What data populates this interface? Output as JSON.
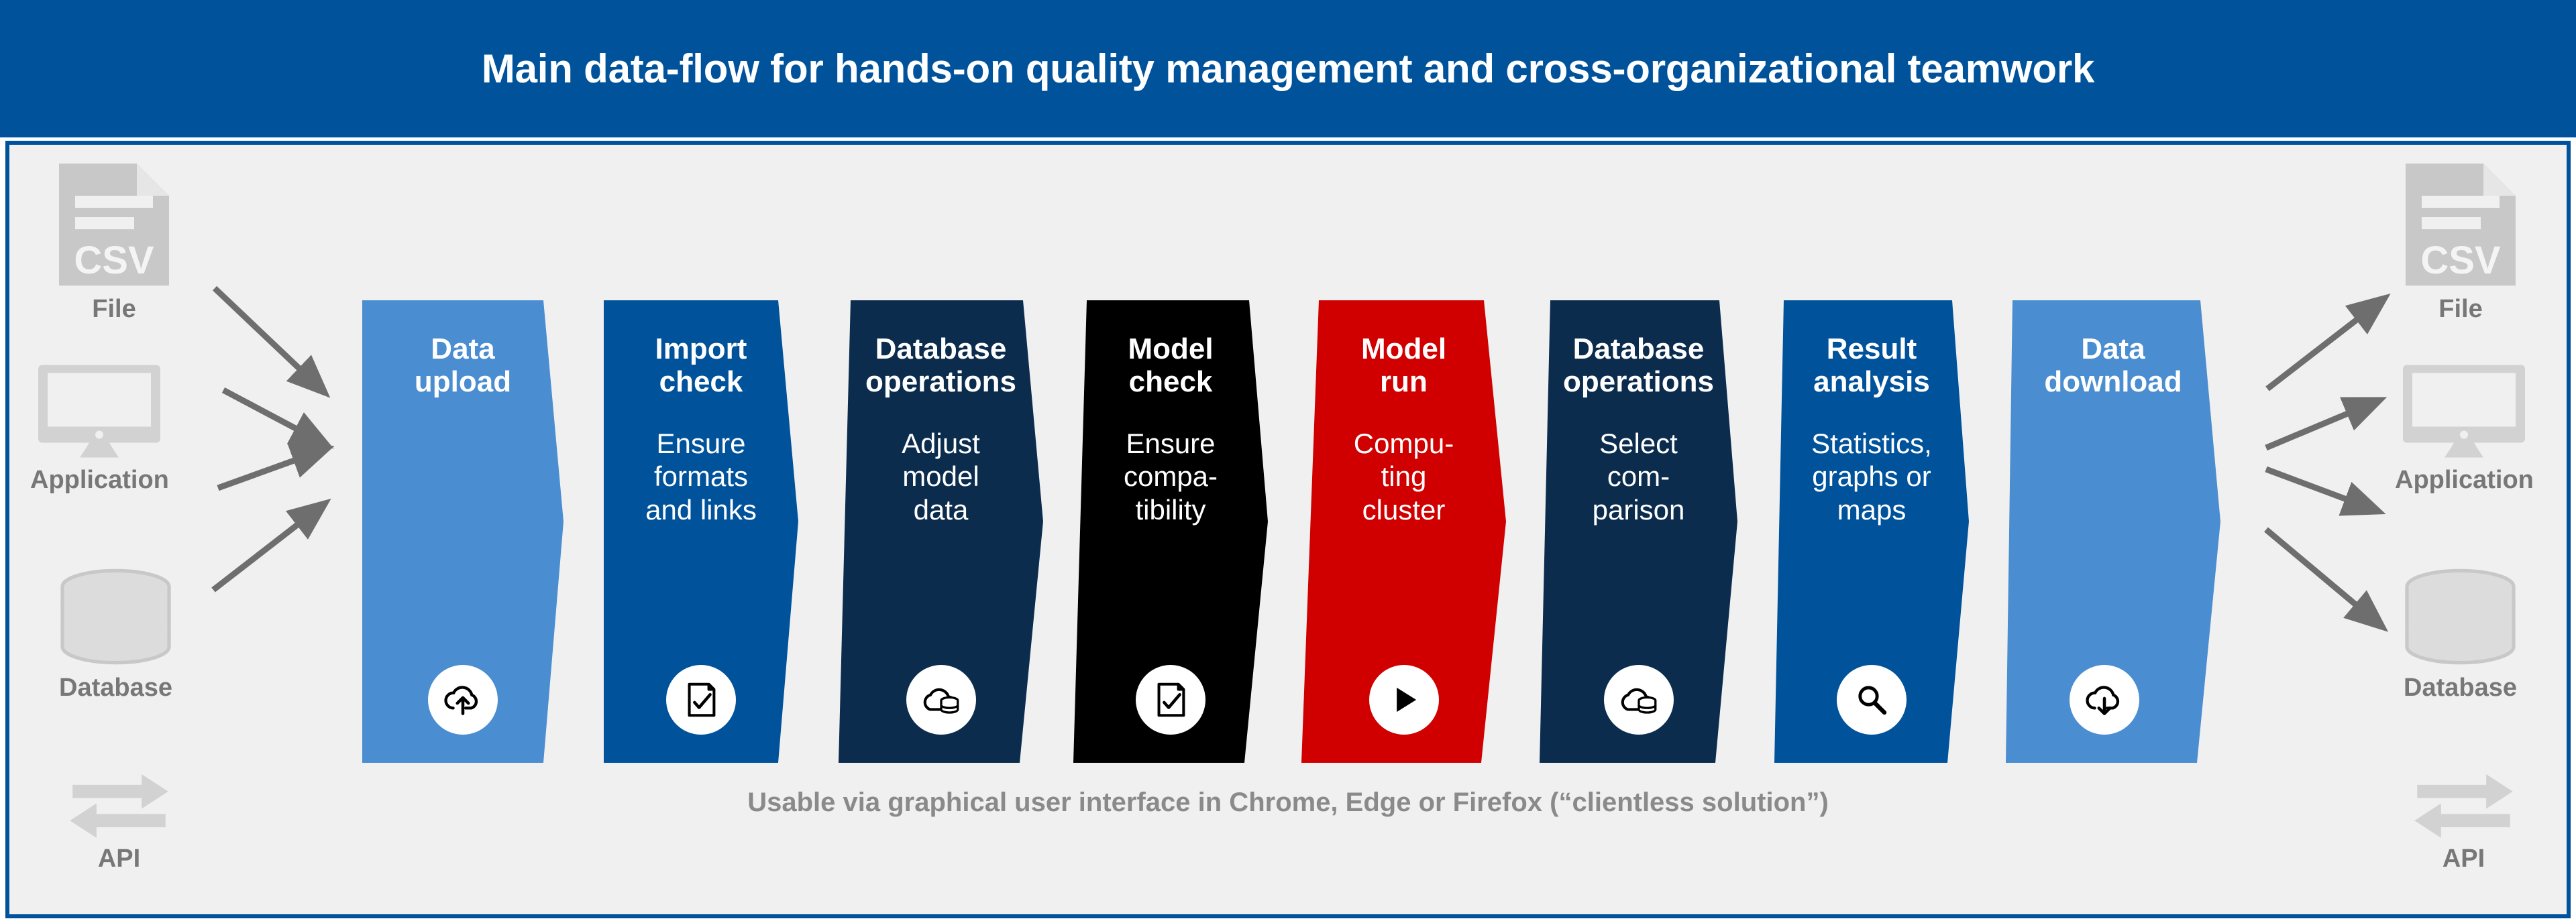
{
  "header": {
    "title": "Main data-flow for hands-on quality management and cross-organizational teamwork"
  },
  "colors": {
    "header_bg": "#00539B",
    "frame_border": "#00539B",
    "frame_bg": "#F0F0F0",
    "light_blue": "#4A8DD0",
    "medium_blue": "#00529B",
    "dark_navy": "#0C2C4E",
    "black": "#000000",
    "red": "#D00000",
    "endpoint_gray": "#C8C8C8",
    "label_gray": "#777777",
    "arrow_gray": "#6E6E6E",
    "caption_gray": "#8A8A8A"
  },
  "inputs": [
    {
      "id": "file",
      "label": "File",
      "icon": "csv-file-icon",
      "badge_text": "CSV"
    },
    {
      "id": "application",
      "label": "Application",
      "icon": "monitor-icon"
    },
    {
      "id": "database",
      "label": "Database",
      "icon": "database-cylinder-icon"
    },
    {
      "id": "api",
      "label": "API",
      "icon": "api-bidirectional-arrows-icon"
    }
  ],
  "outputs": [
    {
      "id": "file",
      "label": "File",
      "icon": "csv-file-icon",
      "badge_text": "CSV"
    },
    {
      "id": "application",
      "label": "Application",
      "icon": "monitor-icon"
    },
    {
      "id": "database",
      "label": "Database",
      "icon": "database-cylinder-icon"
    },
    {
      "id": "api",
      "label": "API",
      "icon": "api-bidirectional-arrows-icon"
    }
  ],
  "steps": [
    {
      "id": "data-upload",
      "title": "Data\nupload",
      "subtitle": "",
      "color": "#4A8DD0",
      "icon": "cloud-upload-icon"
    },
    {
      "id": "import-check",
      "title": "Import\ncheck",
      "subtitle": "Ensure\nformats\nand links",
      "color": "#00529B",
      "icon": "document-check-icon"
    },
    {
      "id": "database-ops-1",
      "title": "Database\noperations",
      "subtitle": "Adjust\nmodel\ndata",
      "color": "#0C2C4E",
      "icon": "cloud-database-icon"
    },
    {
      "id": "model-check",
      "title": "Model\ncheck",
      "subtitle": "Ensure\ncompa-\ntibility",
      "color": "#000000",
      "icon": "document-check-icon"
    },
    {
      "id": "model-run",
      "title": "Model\nrun",
      "subtitle": "Compu-\nting\ncluster",
      "color": "#D00000",
      "icon": "play-icon"
    },
    {
      "id": "database-ops-2",
      "title": "Database\noperations",
      "subtitle": "Select\ncom-\nparison",
      "color": "#0C2C4E",
      "icon": "cloud-database-icon"
    },
    {
      "id": "result-analysis",
      "title": "Result\nanalysis",
      "subtitle": "Statistics,\ngraphs or\nmaps",
      "color": "#00529B",
      "icon": "magnifier-icon"
    },
    {
      "id": "data-download",
      "title": "Data\ndownload",
      "subtitle": "",
      "color": "#4A8DD0",
      "icon": "cloud-download-icon"
    }
  ],
  "caption": {
    "text": "Usable via graphical user interface in Chrome, Edge or Firefox (“clientless solution”)"
  }
}
